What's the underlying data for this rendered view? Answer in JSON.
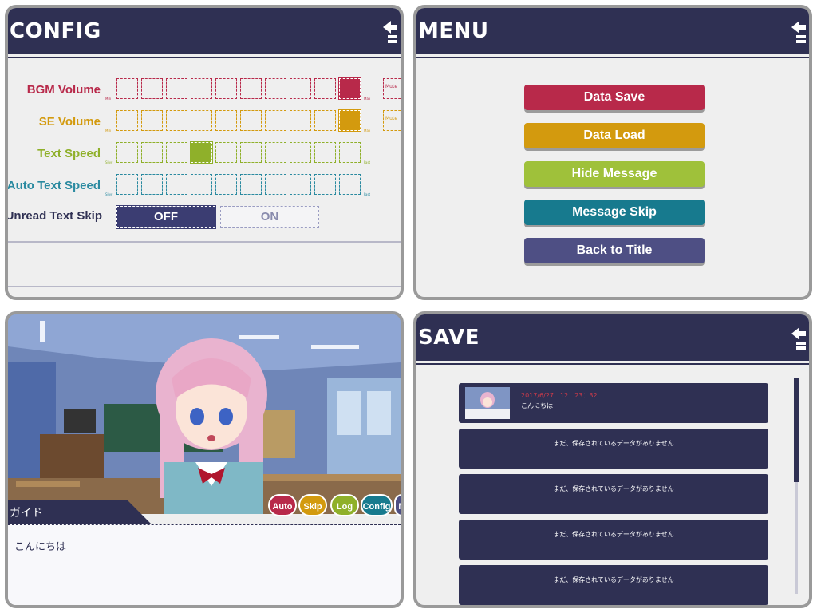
{
  "config": {
    "title": "Config",
    "rows": [
      {
        "label": "BGM Volume",
        "color": "#b8294a",
        "min": "Min",
        "max": "Max",
        "selected": 10,
        "mute": "Mute"
      },
      {
        "label": "SE Volume",
        "color": "#d39a0e",
        "min": "Min",
        "max": "Max",
        "selected": 10,
        "mute": "Mute"
      },
      {
        "label": "Text Speed",
        "color": "#8fb02a",
        "min": "Slow",
        "max": "Fast",
        "selected": 4
      },
      {
        "label": "Auto Text Speed",
        "color": "#2a8aa0",
        "min": "Slow",
        "max": "Fast",
        "selected": null
      }
    ],
    "skip_label": "Unread Text Skip",
    "skip_off": "OFF",
    "skip_on": "ON",
    "skip_value": "OFF"
  },
  "menu": {
    "title": "Menu",
    "buttons": [
      {
        "label": "Data Save",
        "color": "#b8294a"
      },
      {
        "label": "Data Load",
        "color": "#d39a0e"
      },
      {
        "label": "Hide Message",
        "color": "#9fc13a"
      },
      {
        "label": "Message Skip",
        "color": "#177a8e"
      },
      {
        "label": "Back to Title",
        "color": "#4e4f84"
      }
    ]
  },
  "game": {
    "speaker": "ガイド",
    "message": "こんにちは",
    "controls": [
      {
        "label": "Auto",
        "color": "#b8294a"
      },
      {
        "label": "Skip",
        "color": "#d39a0e"
      },
      {
        "label": "Log",
        "color": "#8fb02a"
      },
      {
        "label": "Config",
        "color": "#177a8e"
      },
      {
        "label": "M",
        "color": "#4e4f84"
      }
    ]
  },
  "save": {
    "title": "Save",
    "slots": [
      {
        "date": "2017/6/27　12：23：32",
        "text": "こんにちは",
        "filled": true
      },
      {
        "text": "まだ、保存されているデータがありません",
        "filled": false
      },
      {
        "text": "まだ、保存されているデータがありません",
        "filled": false
      },
      {
        "text": "まだ、保存されているデータがありません",
        "filled": false
      },
      {
        "text": "まだ、保存されているデータがありません",
        "filled": false
      }
    ]
  },
  "colors": {
    "header": "#2f3053",
    "panel_bg": "#efefef",
    "border": "#9a9a9a"
  }
}
